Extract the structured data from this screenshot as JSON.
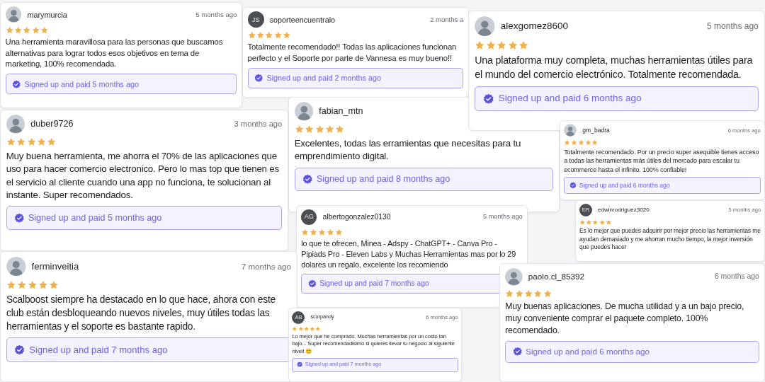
{
  "reviews": [
    {
      "user": "marymurcia",
      "avatar": {
        "kind": "photo"
      },
      "time": "5 months ago",
      "stars": 5,
      "text": "Una herramienta maravillosa para las personas que buscamos alternativas para lograr todos esos objetivos en tema de marketing, 100% recomendada.",
      "badge": "Signed up and paid 5 months ago"
    },
    {
      "user": "soporteencuentralo",
      "avatar": {
        "kind": "initials",
        "text": "JS"
      },
      "time": "2 months a",
      "stars": 5,
      "text": "Totalmente recomendado!! Todas las aplicaciones funcionan perfecto y el Soporte por parte de Vannesa es muy bueno!!",
      "badge": "Signed up and paid 2 months ago"
    },
    {
      "user": "fabian_mtn",
      "avatar": {
        "kind": "photo"
      },
      "stars": 5,
      "text": "Excelentes, todas las erramientas que necesitas para tu emprendimiento digital.",
      "badge": "Signed up and paid 8 months ago"
    },
    {
      "user": "alexgomez8600",
      "avatar": {
        "kind": "photo"
      },
      "time": "5 months ago",
      "stars": 5,
      "text": "Una plataforma muy completa, muchas herramientas útiles para el mundo del comercio electrónico. Totalmente recomendada.",
      "badge": "Signed up and paid 6 months ago"
    },
    {
      "user": "duber9726",
      "avatar": {
        "kind": "photo"
      },
      "time": "3 months ago",
      "stars": 5,
      "text": "Muy buena herramienta, me ahorra el 70% de las aplicaciones que uso para hacer comercio electronico. Pero lo mas top que tienen es el servicio al cliente cuando una app no funciona, te solucionan al instante. Super recomendados.",
      "badge": "Signed up and paid 5 months ago"
    },
    {
      "user": "gm_badra",
      "avatar": {
        "kind": "photo"
      },
      "time": "6 months ago",
      "stars": 5,
      "text": "Totalmente recomendado. Por un precio super asequible tienes acceso a todas las herramientas más útiles del mercado para escalar tu ecommerce hasta el infinito. 100% confiable!",
      "badge": "Signed up and paid 6 months ago"
    },
    {
      "user": "edwinrodriguez3020",
      "avatar": {
        "kind": "initials",
        "text": "ER"
      },
      "time": "5 months ago",
      "stars": 5,
      "text": "Es lo mejor que puedes adquirir por mejor precio las herramientas me ayudan demasiado y me ahorran mucho tiempo, la mejor inversión que puedes hacer"
    },
    {
      "user": "albertogonzalez0130",
      "avatar": {
        "kind": "initials",
        "text": "AG"
      },
      "time": "5 months ago",
      "stars": 5,
      "text": "lo que te ofrecen, Minea - Adspy - ChatGPT+ - Canva Pro - Pipiads Pro - Eleven Labs y Muchas Herramientas mas por lo 29 dolares un regalo, excelente los recomiendo",
      "badge": "Signed up and paid 7 months ago"
    },
    {
      "user": "ferminveitia",
      "avatar": {
        "kind": "photo"
      },
      "time": "7 months ago",
      "stars": 5,
      "text": "Scalboost siempre ha destacado en lo que hace, ahora con este club están desbloqueando nuevos niveles, muy útiles todas las herramientas y el soporte es bastante rapido.",
      "badge": "Signed up and paid 7 months ago"
    },
    {
      "user": "scorpandy",
      "avatar": {
        "kind": "initials",
        "text": "AB"
      },
      "time": "6 months ago",
      "stars": 5,
      "text": "Lo mejor que he comprado. Muchas herramientas por un costo tan bajo... Super recomendadisimo si quieres llevar tu negocio al siguiente nivel! 😊",
      "badge": "Signed up and paid 7 months ago"
    },
    {
      "user": "paolo.cl_85392",
      "avatar": {
        "kind": "photo"
      },
      "time": "6 months ago",
      "stars": 5,
      "text": "Muy buenas aplicaciones. De mucha utilidad y a un bajo precio, muy conveniente comprar el paquete completo. 100% recomendado.",
      "badge": "Signed up and paid 6 months ago"
    }
  ]
}
